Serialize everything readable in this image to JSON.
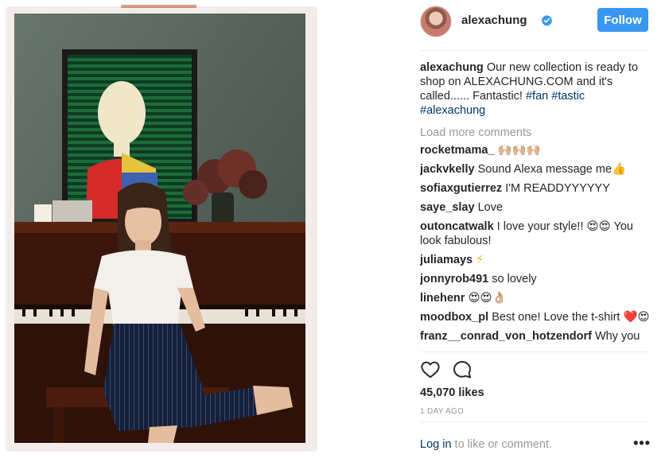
{
  "post": {
    "username": "alexachung",
    "follow_label": "Follow",
    "caption": {
      "username": "alexachung",
      "text": "Our new collection is ready to shop on ALEXACHUNG.COM and it's called...... Fantastic!",
      "hashtags": [
        "#fan",
        "#tastic",
        "#alexachung"
      ]
    },
    "load_more_label": "Load more comments",
    "comments": [
      {
        "user": "rocketmama_",
        "text": "🙌🏼🙌🏼🙌🏼"
      },
      {
        "user": "jackvkelly",
        "text": "Sound Alexa message me👍"
      },
      {
        "user": "sofiaxgutierrez",
        "text": "I'M READDYYYYYY"
      },
      {
        "user": "saye_slay",
        "text": "Love"
      },
      {
        "user": "outoncatwalk",
        "text": "I love your style!! 😍😍 You look fabulous!"
      },
      {
        "user": "juliamays",
        "text": "⚡"
      },
      {
        "user": "jonnyrob491",
        "text": "so lovely"
      },
      {
        "user": "linehenr",
        "text": "😍😍👌🏼"
      },
      {
        "user": "moodbox_pl",
        "text": "Best one! Love the t-shirt ❤️😍"
      },
      {
        "user": "franz__conrad_von_hotzendorf",
        "text": "Why you"
      }
    ],
    "likes": "45,070 likes",
    "timestamp": "1 DAY AGO",
    "login_link": "Log in",
    "login_suffix": " to like or comment.",
    "more_icon": "•••"
  },
  "icons": {
    "verified": "verified-badge-icon",
    "heart": "heart-icon",
    "comment": "comment-bubble-icon",
    "more": "more-options-icon"
  },
  "colors": {
    "accent": "#3897f0",
    "link": "#003569",
    "muted": "#999999"
  }
}
